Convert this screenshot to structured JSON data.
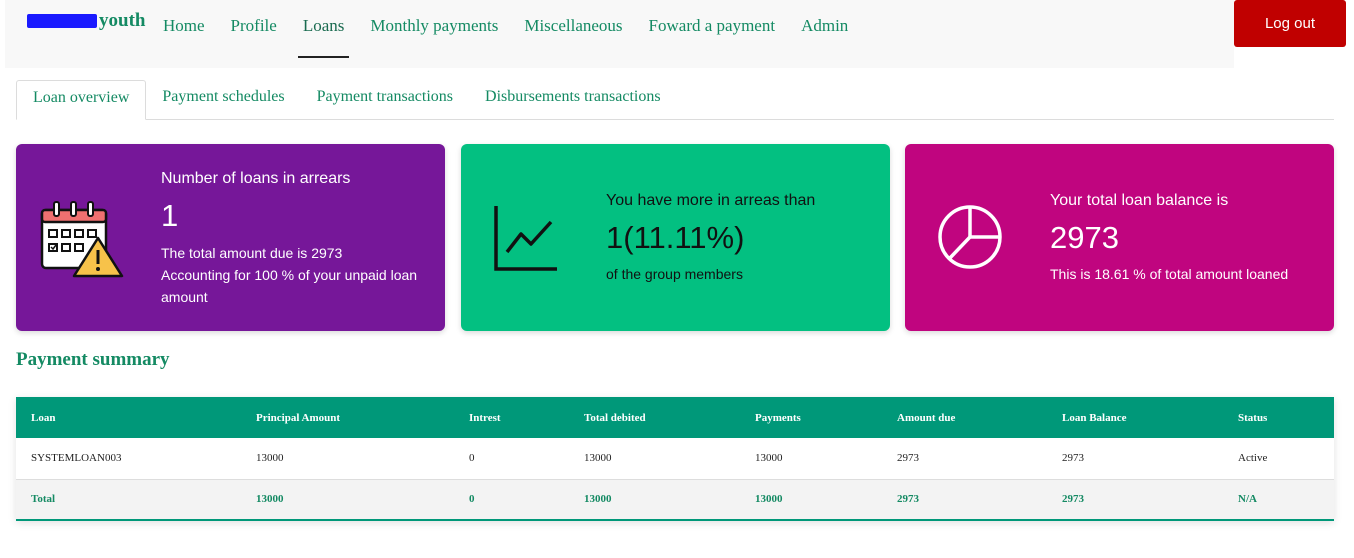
{
  "brand": {
    "name": "youth"
  },
  "nav": {
    "items": [
      "Home",
      "Profile",
      "Loans",
      "Monthly payments",
      "Miscellaneous",
      "Foward a payment",
      "Admin"
    ],
    "active": "Loans",
    "logout_label": "Log out"
  },
  "tabs": [
    "Loan overview",
    "Payment schedules",
    "Payment transactions",
    "Disbursements transactions"
  ],
  "cards": {
    "arrears": {
      "title": "Number of loans in arrears",
      "value": "1",
      "line1": "The total amount due is 2973",
      "line2": "Accounting for 100 % of your unpaid loan amount",
      "icon": "calendar-warning-icon",
      "color": "#761799"
    },
    "members": {
      "title": "You have more in arreas than",
      "value": "1(11.11%)",
      "line1": "of the group members",
      "icon": "line-chart-icon",
      "color": "#03c081"
    },
    "balance": {
      "title": "Your total loan balance is",
      "value": "2973",
      "line1": "This is 18.61 % of total amount loaned",
      "icon": "pie-chart-icon",
      "color": "#c0057f"
    }
  },
  "summary": {
    "title": "Payment summary",
    "headers": [
      "Loan",
      "Principal Amount",
      "Intrest",
      "Total debited",
      "Payments",
      "Amount due",
      "Loan Balance",
      "Status"
    ],
    "rows": [
      [
        "SYSTEMLOAN003",
        "13000",
        "0",
        "13000",
        "13000",
        "2973",
        "2973",
        "Active"
      ]
    ],
    "total": [
      "Total",
      "13000",
      "0",
      "13000",
      "13000",
      "2973",
      "2973",
      "N/A"
    ]
  },
  "colors": {
    "accent": "#148a63",
    "table_header": "#009879",
    "logout": "#c00000"
  }
}
